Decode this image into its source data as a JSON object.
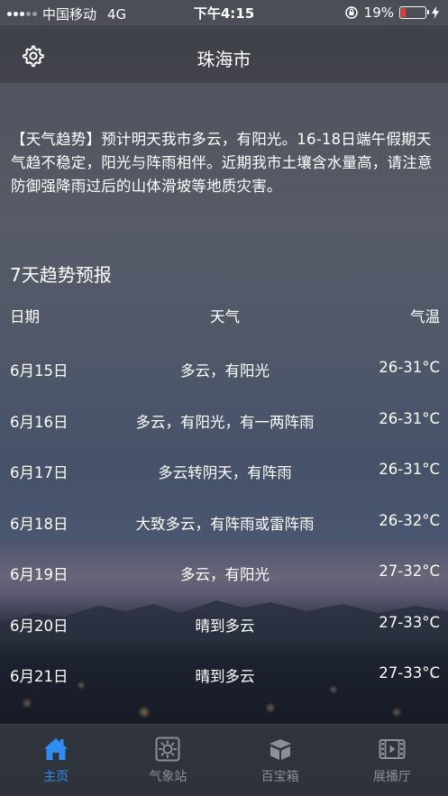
{
  "status_bar": {
    "carrier": "中国移动",
    "network": "4G",
    "time": "下午4:15",
    "battery_percent": "19%",
    "battery_level": 0.19
  },
  "header": {
    "title": "珠海市",
    "settings_icon": "gear-icon"
  },
  "trend": {
    "text": "【天气趋势】预计明天我市多云，有阳光。16-18日端午假期天气趋不稳定，阳光与阵雨相伴。近期我市土壤含水量高，请注意防御强降雨过后的山体滑坡等地质灾害。"
  },
  "forecast": {
    "title": "7天趋势预报",
    "headers": {
      "date": "日期",
      "weather": "天气",
      "temp": "气温"
    },
    "rows": [
      {
        "date": "6月15日",
        "weather": "多云，有阳光",
        "temp": "26-31°C"
      },
      {
        "date": "6月16日",
        "weather": "多云，有阳光，有一两阵雨",
        "temp": "26-31°C"
      },
      {
        "date": "6月17日",
        "weather": "多云转阴天，有阵雨",
        "temp": "26-31°C"
      },
      {
        "date": "6月18日",
        "weather": "大致多云，有阵雨或雷阵雨",
        "temp": "26-32°C"
      },
      {
        "date": "6月19日",
        "weather": "多云，有阳光",
        "temp": "27-32°C"
      },
      {
        "date": "6月20日",
        "weather": "晴到多云",
        "temp": "27-33°C"
      },
      {
        "date": "6月21日",
        "weather": "晴到多云",
        "temp": "27-33°C"
      }
    ]
  },
  "tabbar": {
    "active_color": "#2f8cf0",
    "inactive_color": "#8e8f95",
    "tabs": [
      {
        "label": "主页",
        "icon": "home-icon",
        "active": true
      },
      {
        "label": "气象站",
        "icon": "sun-icon",
        "active": false
      },
      {
        "label": "百宝箱",
        "icon": "box-icon",
        "active": false
      },
      {
        "label": "展播厅",
        "icon": "film-icon",
        "active": false
      }
    ]
  }
}
